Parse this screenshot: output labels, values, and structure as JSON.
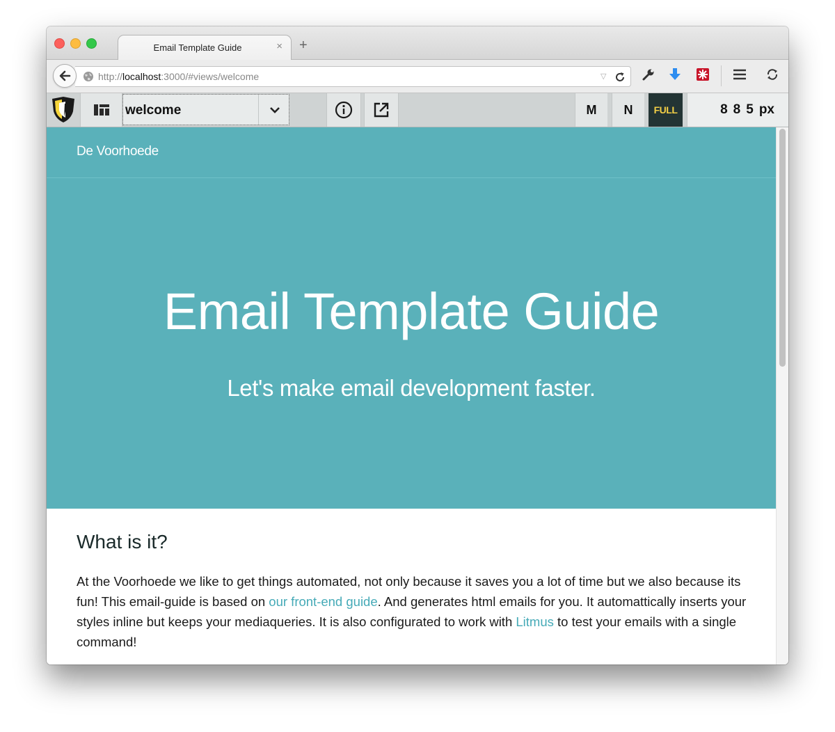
{
  "browser": {
    "tab_title": "Email Template Guide",
    "tab_close": "×",
    "new_tab": "+",
    "url_prefix": "http://",
    "url_host": "localhost",
    "url_rest": ":3000/#views/welcome"
  },
  "toolbar": {
    "view_name": "welcome",
    "size_m": "M",
    "size_n": "N",
    "size_full": "FULL",
    "width_value": "885",
    "width_unit": "px"
  },
  "page": {
    "brand": "De Voorhoede",
    "hero_title": "Email Template Guide",
    "hero_subtitle": "Let's make email development faster.",
    "section_title": "What is it?",
    "paragraph": {
      "part1": "At the Voorhoede we like to get things automated, not only because it saves you a lot of time but we also because its fun! This email-guide is based on ",
      "link1": "our front-end guide",
      "part2": ". And generates html emails for you. It automattically inserts your styles inline but keeps your mediaqueries. It is also configurated to work with ",
      "link2": "Litmus",
      "part3": " to test your emails with a single command!"
    }
  },
  "colors": {
    "hero_bg": "#5ab1ba",
    "link": "#45aab7",
    "full_bg": "#233434",
    "full_text": "#f3cf46"
  },
  "icons": [
    "back-arrow-icon",
    "globe-icon",
    "dropdown-triangle-icon",
    "reload-icon",
    "wrench-icon",
    "download-arrow-icon",
    "addon-red-icon",
    "hamburger-menu-icon",
    "sync-icon",
    "shield-logo-icon",
    "layout-grid-icon",
    "chevron-down-icon",
    "info-icon",
    "external-link-icon"
  ]
}
